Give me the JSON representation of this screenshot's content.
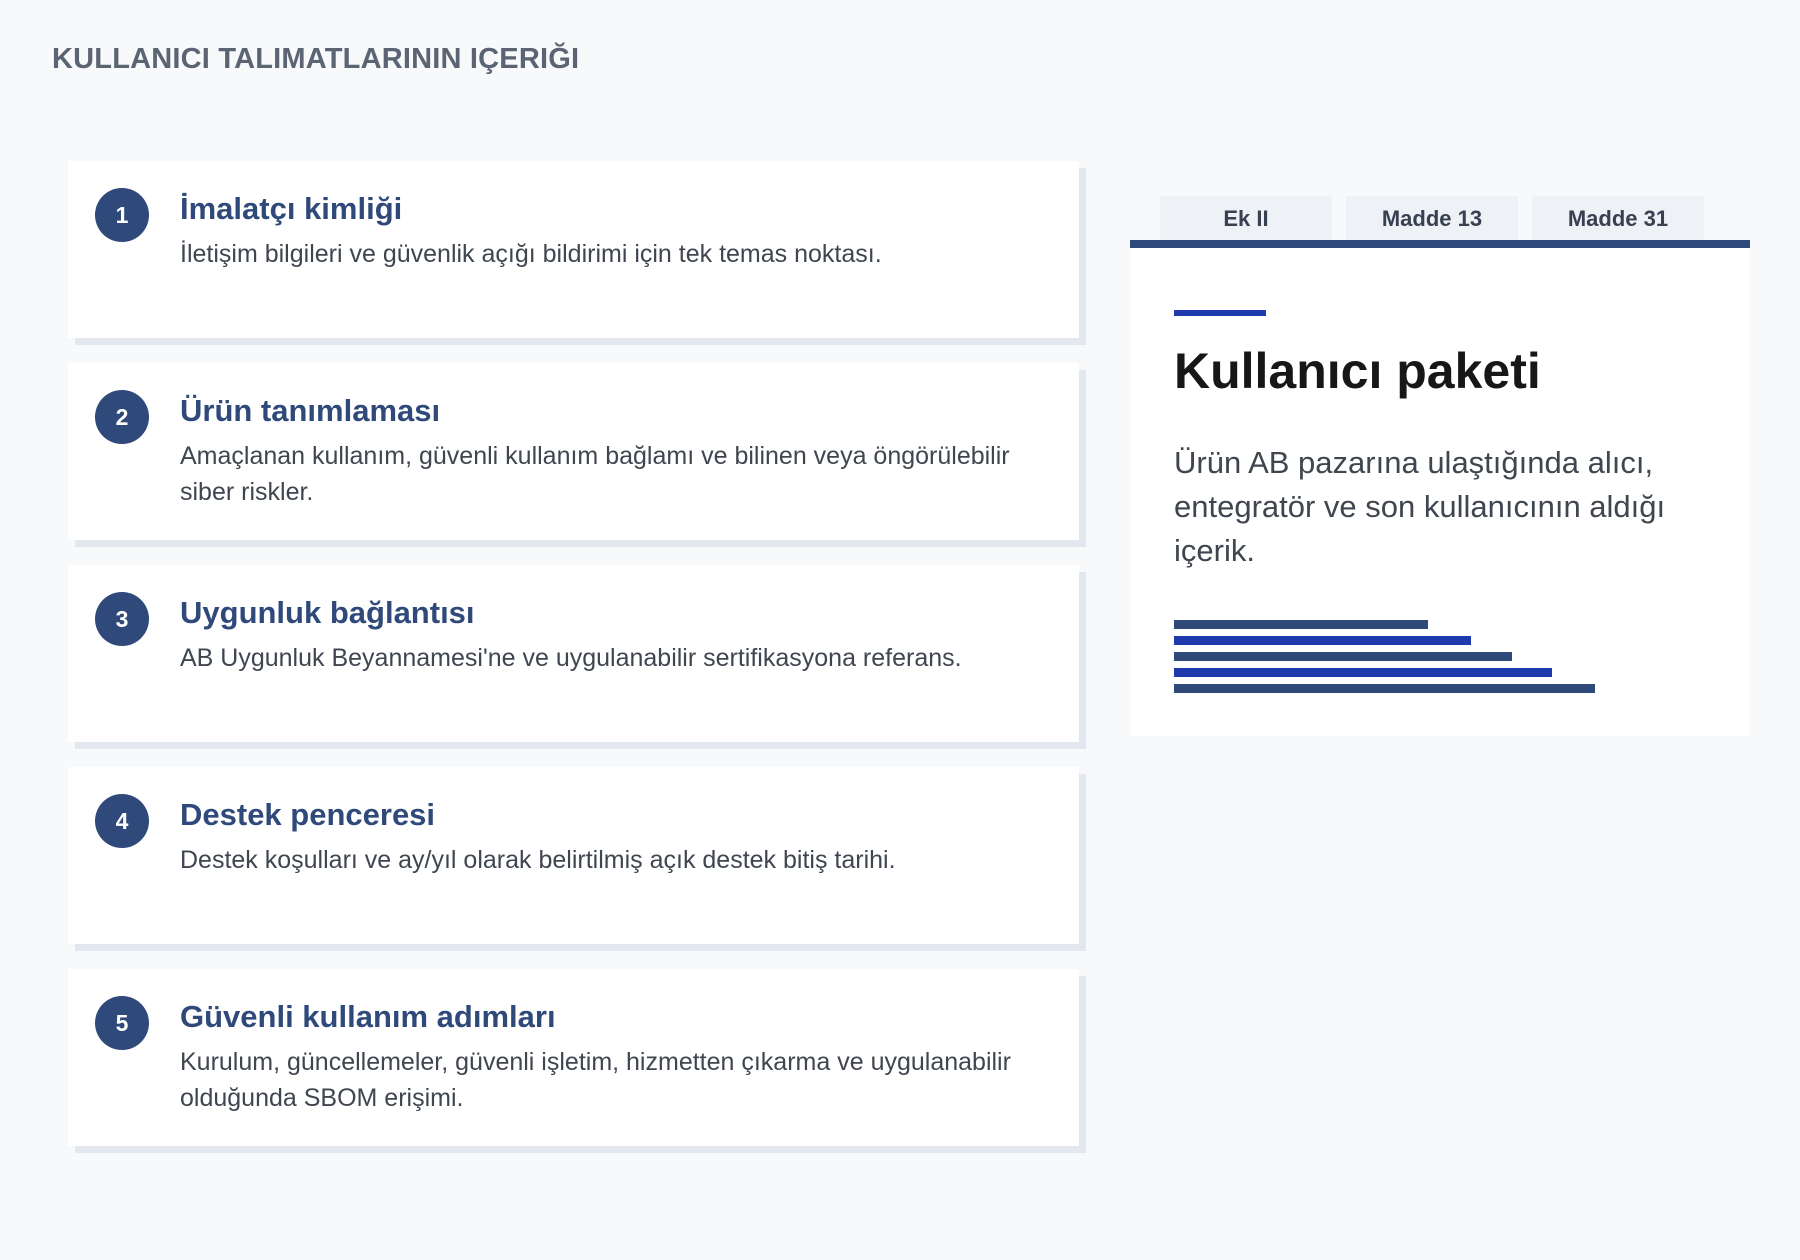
{
  "header": {
    "title": "KULLANICI TALIMATLARININ IÇERIĞI"
  },
  "steps": [
    {
      "number": "1",
      "title": "İmalatçı kimliği",
      "description": "İletişim bilgileri ve güvenlik açığı bildirimi için tek temas noktası."
    },
    {
      "number": "2",
      "title": "Ürün tanımlaması",
      "description": "Amaçlanan kullanım, güvenli kullanım bağlamı ve bilinen veya öngörülebilir siber riskler."
    },
    {
      "number": "3",
      "title": "Uygunluk bağlantısı",
      "description": "AB Uygunluk Beyannamesi'ne ve uygulanabilir sertifikasyona referans."
    },
    {
      "number": "4",
      "title": "Destek penceresi",
      "description": "Destek koşulları ve ay/yıl olarak belirtilmiş açık destek bitiş tarihi."
    },
    {
      "number": "5",
      "title": "Güvenli kullanım adımları",
      "description": "Kurulum, güncellemeler, güvenli işletim, hizmetten çıkarma ve uygulanabilir olduğunda SBOM erişimi."
    }
  ],
  "panel": {
    "tabs": [
      "Ek II",
      "Madde 13",
      "Madde 31"
    ],
    "title": "Kullanıcı paketi",
    "description": "Ürün AB pazarına ulaştığında alıcı, entegratör ve son kullanıcının aldığı içerik.",
    "decorative_bars": [
      {
        "fraction": 0.47,
        "color": "#2f4a7a"
      },
      {
        "fraction": 0.55,
        "color": "#1e3aad"
      },
      {
        "fraction": 0.625,
        "color": "#2f4a7a"
      },
      {
        "fraction": 0.7,
        "color": "#1e3aad"
      },
      {
        "fraction": 0.78,
        "color": "#2f4a7a"
      }
    ]
  },
  "colors": {
    "primary": "#2f4a7a",
    "accent": "#1e3aad",
    "background": "#f8f9fb"
  }
}
